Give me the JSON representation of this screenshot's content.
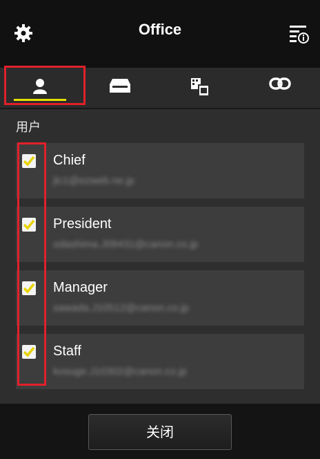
{
  "header": {
    "title": "Office",
    "settings_icon": "gear-icon",
    "info_icon": "info-menu-icon"
  },
  "tabs": [
    {
      "name": "users",
      "icon": "user-icon",
      "selected": true
    },
    {
      "name": "printers",
      "icon": "printer-icon",
      "selected": false
    },
    {
      "name": "apps",
      "icon": "apps-icon",
      "selected": false
    },
    {
      "name": "links",
      "icon": "link-icon",
      "selected": false
    }
  ],
  "section_label": "用户",
  "users": [
    {
      "name": "Chief",
      "email": "jlc1@ezweb.ne.jp",
      "checked": true
    },
    {
      "name": "President",
      "email": "odashima.J09431@canon.co.jp",
      "checked": true
    },
    {
      "name": "Manager",
      "email": "sawada.J10512@canon.co.jp",
      "checked": true
    },
    {
      "name": "Staff",
      "email": "kosuge.J10302@canon.co.jp",
      "checked": true
    }
  ],
  "footer": {
    "close_label": "关闭"
  },
  "colors": {
    "accent": "#e8e000",
    "highlight": "#e2202a",
    "header_bg": "#111111"
  }
}
